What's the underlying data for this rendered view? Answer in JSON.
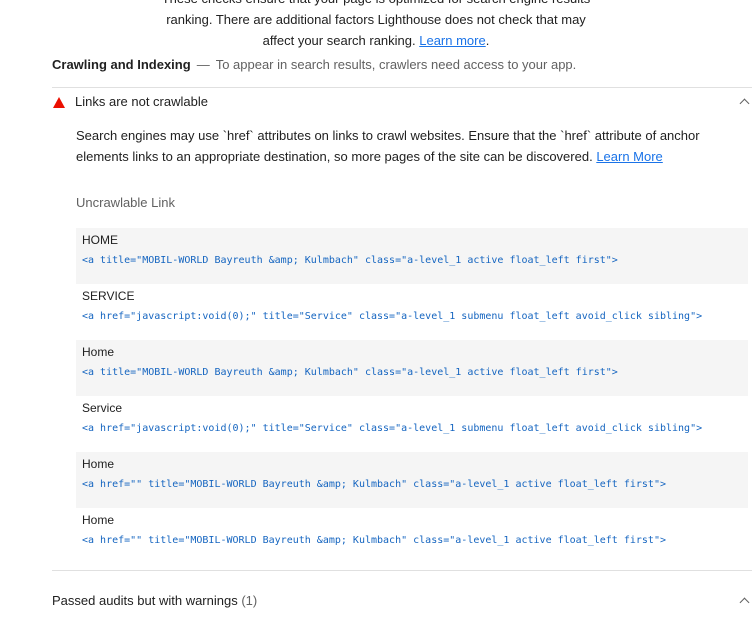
{
  "intro": {
    "line1": "These checks ensure that your page is optimized for search engine results",
    "line2": "ranking. There are additional factors Lighthouse does not check that may",
    "line3_prefix": "affect your search ranking. ",
    "learn_more": "Learn more",
    "line3_suffix": "."
  },
  "group": {
    "title": "Crawling and Indexing",
    "separator": "—",
    "description": "To appear in search results, crawlers need access to your app."
  },
  "audit": {
    "title": "Links are not crawlable",
    "status_color": "#eb0f00",
    "description": "Search engines may use `href` attributes on links to crawl websites. Ensure that the `href` attribute of anchor elements links to an appropriate destination, so more pages of the site can be discovered. ",
    "learn_more": "Learn More",
    "column_header": "Uncrawlable Link",
    "rows": [
      {
        "label": "HOME",
        "snippet": "<a title=\"MOBIL-WORLD Bayreuth &amp; Kulmbach\" class=\"a-level_1 active float_left first\">"
      },
      {
        "label": "SERVICE",
        "snippet": "<a href=\"javascript:void(0);\" title=\"Service\" class=\"a-level_1 submenu float_left avoid_click sibling\">"
      },
      {
        "label": "Home",
        "snippet": "<a title=\"MOBIL-WORLD Bayreuth &amp; Kulmbach\" class=\"a-level_1 active float_left first\">"
      },
      {
        "label": "Service",
        "snippet": "<a href=\"javascript:void(0);\" title=\"Service\" class=\"a-level_1 submenu float_left avoid_click sibling\">"
      },
      {
        "label": "Home",
        "snippet": "<a href=\"\" title=\"MOBIL-WORLD Bayreuth &amp; Kulmbach\" class=\"a-level_1 active float_left first\">"
      },
      {
        "label": "Home",
        "snippet": "<a href=\"\" title=\"MOBIL-WORLD Bayreuth &amp; Kulmbach\" class=\"a-level_1 active float_left first\">"
      }
    ]
  },
  "passed": {
    "title": "Passed audits but with warnings",
    "count": "(1)"
  },
  "icons": {
    "fail": "warning-triangle-icon",
    "collapse": "chevron-up-icon"
  },
  "colors": {
    "link": "#1a73e8",
    "code": "#1565c0",
    "row_alt_bg": "#f5f5f5"
  }
}
